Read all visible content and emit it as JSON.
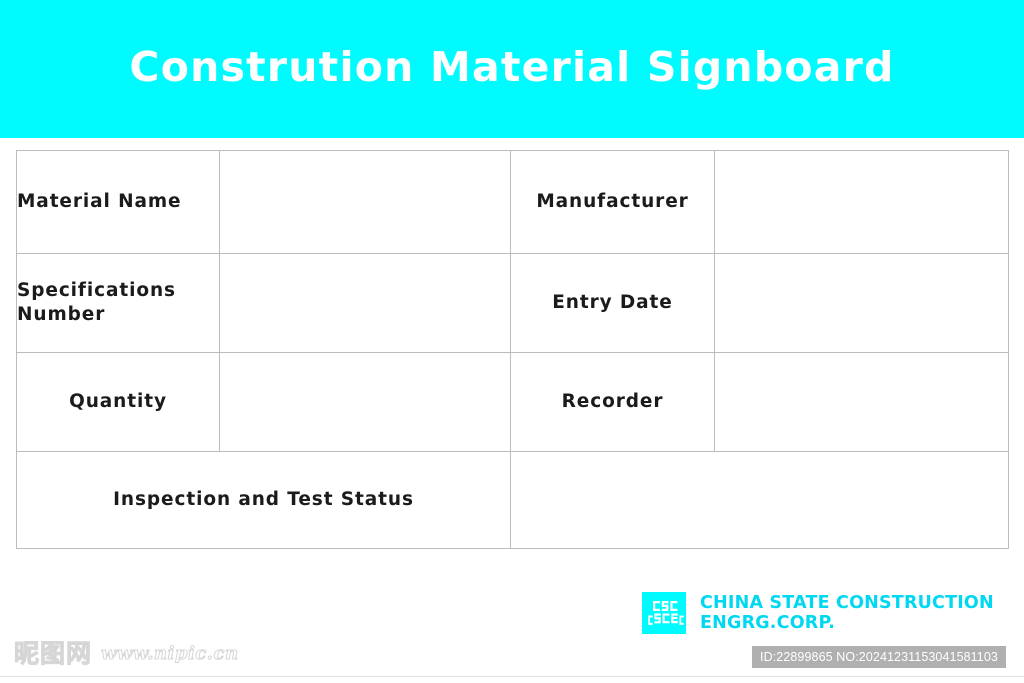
{
  "header": {
    "title": "Constrution Material Signboard",
    "background_color": "#00FBFF",
    "title_color": "#FFFFFF"
  },
  "table": {
    "border_color": "#BCBCBC",
    "rows": [
      {
        "cells": [
          {
            "label": "Material Name",
            "align": "left",
            "type": "label"
          },
          {
            "label": "",
            "align": "left",
            "type": "value"
          },
          {
            "label": "Manufacturer",
            "align": "center",
            "type": "label"
          },
          {
            "label": "",
            "align": "left",
            "type": "value"
          }
        ]
      },
      {
        "cells": [
          {
            "label": "Specifications Number",
            "align": "left",
            "type": "label"
          },
          {
            "label": "",
            "align": "left",
            "type": "value"
          },
          {
            "label": "Entry Date",
            "align": "center",
            "type": "label"
          },
          {
            "label": "",
            "align": "left",
            "type": "value"
          }
        ]
      },
      {
        "cells": [
          {
            "label": "Quantity",
            "align": "center",
            "type": "label"
          },
          {
            "label": "",
            "align": "left",
            "type": "value"
          },
          {
            "label": "Recorder",
            "align": "center",
            "type": "label"
          },
          {
            "label": "",
            "align": "left",
            "type": "value"
          }
        ]
      }
    ],
    "last_row": {
      "label": "Inspection and Test Status",
      "value": ""
    },
    "labels": {
      "material_name": "Material Name",
      "specifications_number_line1": "Specifications",
      "specifications_number_line2": "Number",
      "quantity": "Quantity",
      "manufacturer": "Manufacturer",
      "entry_date": "Entry Date",
      "recorder": "Recorder",
      "inspection_and_test_status": "Inspection and Test Status"
    },
    "values": {
      "material_name": "",
      "specifications_number": "",
      "quantity": "",
      "manufacturer": "",
      "entry_date": "",
      "recorder": "",
      "inspection_and_test_status": ""
    }
  },
  "footer": {
    "logo": {
      "icon": "cscec-logo-icon",
      "mark_text": "CSCEC",
      "mark_background": "#00FBFF",
      "mark_glyph_color": "#FFFFFF"
    },
    "company_line1": "CHINA STATE CONSTRUCTION",
    "company_line2": "ENGRG.CORP.",
    "company_color": "#00D8F2"
  },
  "id_bar": {
    "text": "ID:22899865 NO:20241231153041581103",
    "background_color": "#B0B0B0",
    "text_color": "#FFFFFF"
  },
  "watermark": {
    "cjk_text": "昵图网",
    "url_text": "www.nipic.cn",
    "color": "#CFCFCF"
  }
}
